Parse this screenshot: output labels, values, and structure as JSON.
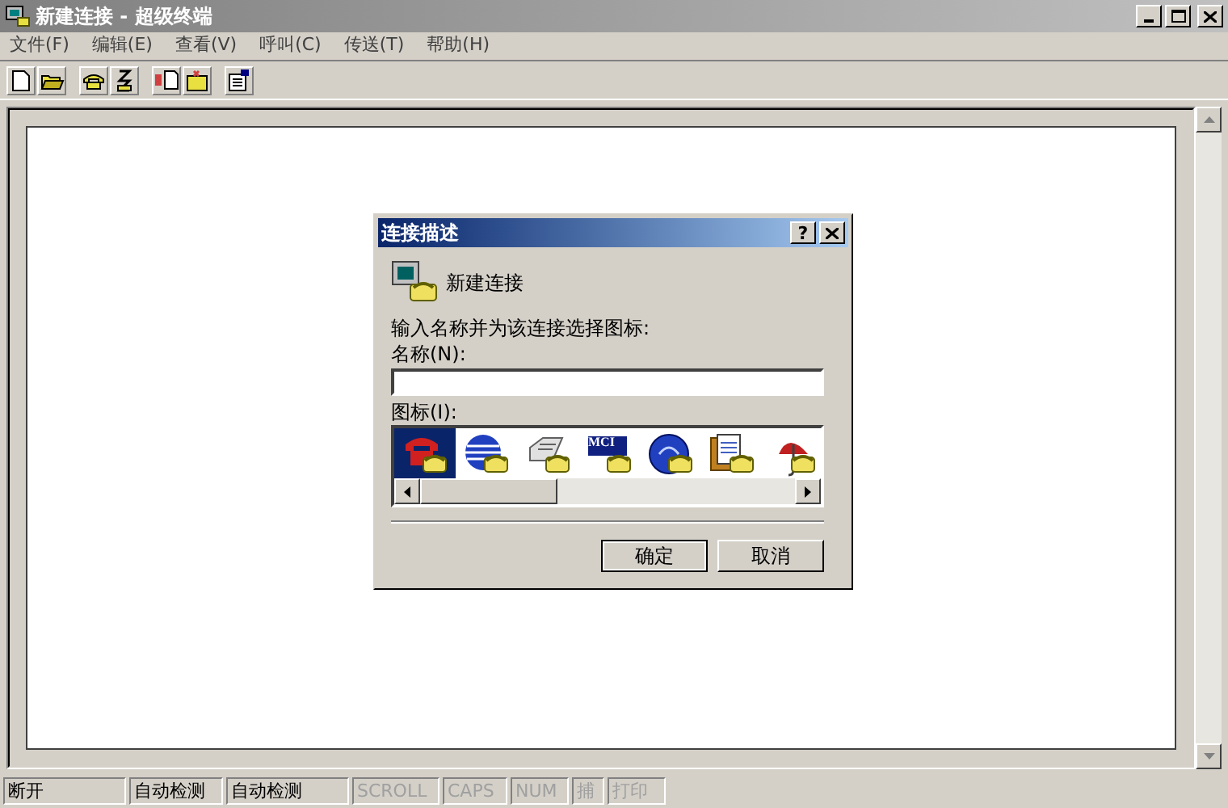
{
  "window": {
    "title": "新建连接 - 超级终端"
  },
  "menu": [
    {
      "label": "文件(F)"
    },
    {
      "label": "编辑(E)"
    },
    {
      "label": "查看(V)"
    },
    {
      "label": "呼叫(C)"
    },
    {
      "label": "传送(T)"
    },
    {
      "label": "帮助(H)"
    }
  ],
  "dialog": {
    "title": "连接描述",
    "help_button": "?",
    "connection_name": "新建连接",
    "prompt": "输入名称并为该连接选择图标:",
    "name_label": "名称(N):",
    "icon_label": "图标(I):",
    "icons": [
      {
        "kind": "phone",
        "selected": true
      },
      {
        "kind": "globe",
        "selected": false
      },
      {
        "kind": "fax",
        "selected": false
      },
      {
        "kind": "logo",
        "label": "MCI",
        "selected": false
      },
      {
        "kind": "circle",
        "selected": false
      },
      {
        "kind": "document",
        "selected": false
      },
      {
        "kind": "umbrella",
        "selected": false
      }
    ],
    "buttons": [
      "确定",
      "取消"
    ]
  },
  "status_bar": [
    {
      "text": "断开",
      "disabled": false
    },
    {
      "text": "自动检测",
      "disabled": false
    },
    {
      "text": "自动检测",
      "disabled": false
    },
    {
      "text": "SCROLL",
      "disabled": true
    },
    {
      "text": "CAPS",
      "disabled": true
    },
    {
      "text": "NUM",
      "disabled": true
    },
    {
      "text": "捕",
      "disabled": true
    },
    {
      "text": "打印",
      "disabled": true
    }
  ]
}
